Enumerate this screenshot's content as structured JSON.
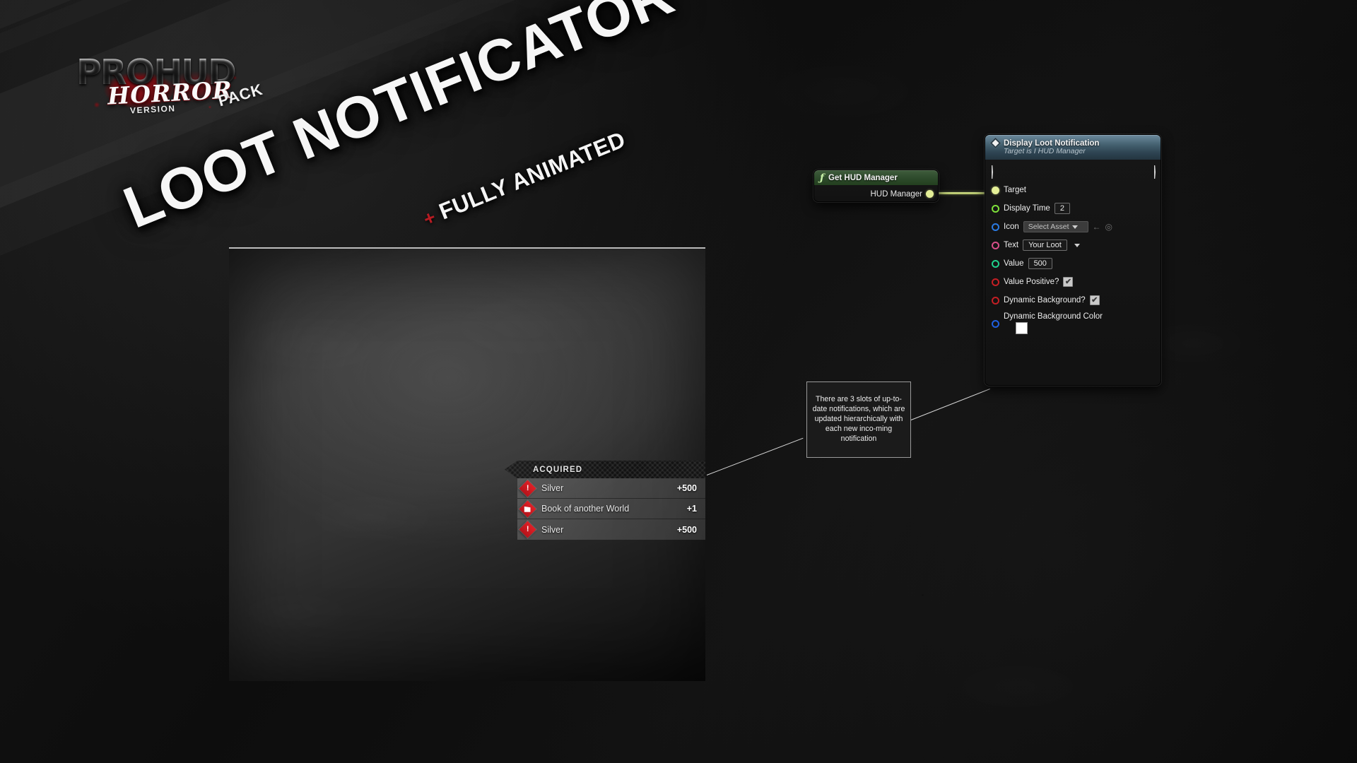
{
  "branding": {
    "logo_main": "PROHUD",
    "logo_horror": "HORROR",
    "logo_version": "VERSION",
    "logo_pack": "PACK",
    "accent_red": "#b81c23"
  },
  "title": {
    "main": "LOOT NOTIFICATOR",
    "subtitle_plus": "+",
    "subtitle": "FULLY ANIMATED"
  },
  "loot_widget": {
    "banner_label": "ACQUIRED",
    "rows": [
      {
        "icon": "alert-diamond-icon",
        "name": "Silver",
        "value": "+500"
      },
      {
        "icon": "book-diamond-icon",
        "name": "Book of another World",
        "value": "+1"
      },
      {
        "icon": "alert-diamond-icon",
        "name": "Silver",
        "value": "+500"
      }
    ]
  },
  "callout": {
    "text": "There are 3 slots of up-to-date notifications, which are updated hierarchically with each new inco-ming notification"
  },
  "blueprint": {
    "hud_node": {
      "title": "Get HUD Manager",
      "output_pin_label": "HUD Manager"
    },
    "loot_node": {
      "title": "Display Loot Notification",
      "subtitle": "Target is I HUD Manager",
      "pins": [
        {
          "label": "Target",
          "pin_style": "filled",
          "pin_color": "#e4ef97",
          "control": "none"
        },
        {
          "label": "Display Time",
          "pin_style": "hollow",
          "pin_color": "#7ee03a",
          "control": "text",
          "value": "2"
        },
        {
          "label": "Icon",
          "pin_style": "hollow",
          "pin_color": "#2a7ae2",
          "control": "asset",
          "value": "Select Asset"
        },
        {
          "label": "Text",
          "pin_style": "hollow",
          "pin_color": "#d94f8a",
          "control": "combo",
          "value": "Your Loot"
        },
        {
          "label": "Value",
          "pin_style": "hollow",
          "pin_color": "#1fd18c",
          "control": "text",
          "value": "500"
        },
        {
          "label": "Value Positive?",
          "pin_style": "hollow",
          "pin_color": "#c41f24",
          "control": "checkbox",
          "value": "✔"
        },
        {
          "label": "Dynamic Background?",
          "pin_style": "hollow",
          "pin_color": "#c41f24",
          "control": "checkbox",
          "value": "✔"
        },
        {
          "label": "Dynamic Background Color",
          "pin_style": "hollow",
          "pin_color": "#1f5fe0",
          "control": "color",
          "value": "#ffffff"
        }
      ]
    }
  }
}
